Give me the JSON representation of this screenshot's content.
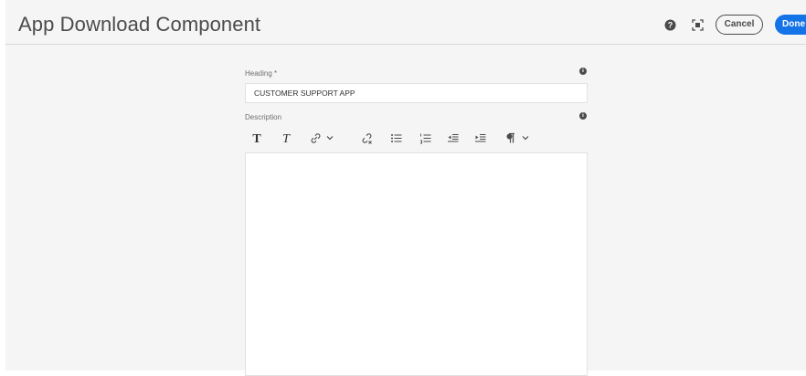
{
  "header": {
    "title": "App Download Component",
    "cancel_label": "Cancel",
    "done_label": "Done",
    "icons": [
      "help-icon",
      "fullscreen-icon"
    ]
  },
  "form": {
    "heading": {
      "label": "Heading *",
      "value": "CUSTOMER SUPPORT APP"
    },
    "description": {
      "label": "Description",
      "value": ""
    }
  },
  "toolbar": {
    "items": [
      "bold-icon",
      "italic-icon",
      "link-icon",
      "link-dropdown-icon",
      "unlink-icon",
      "bullet-list-icon",
      "numbered-list-icon",
      "outdent-icon",
      "indent-icon",
      "paragraph-icon",
      "paragraph-dropdown-icon"
    ]
  },
  "colors": {
    "accent": "#1473e6",
    "panel_bg": "#f5f5f5",
    "text": "#4b4b4b"
  }
}
